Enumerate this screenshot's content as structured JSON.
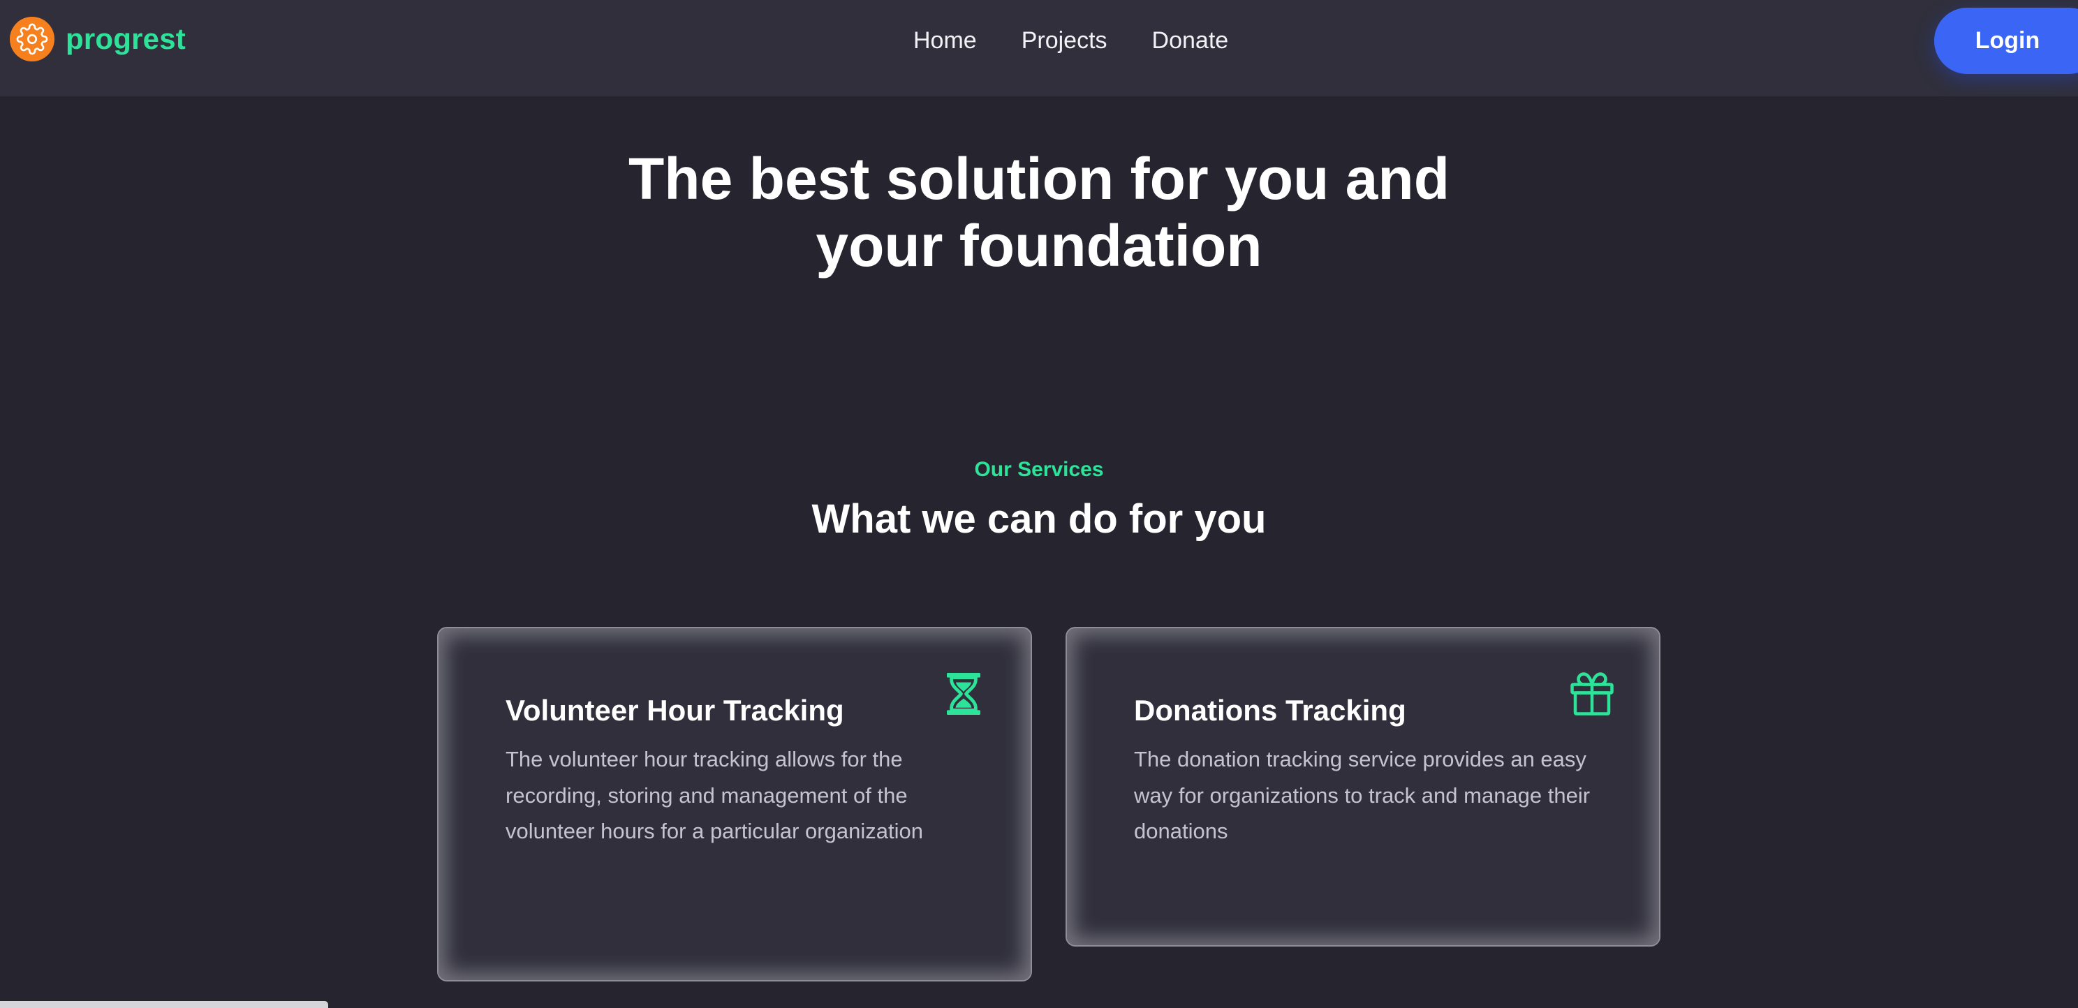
{
  "header": {
    "brand": "progrest",
    "nav": [
      "Home",
      "Projects",
      "Donate"
    ],
    "login_label": "Login"
  },
  "hero": {
    "title_line1": "The best solution for you and",
    "title_line2": "your foundation"
  },
  "services": {
    "eyebrow": "Our Services",
    "title": "What we can do for you",
    "cards": [
      {
        "title": "Volunteer Hour Tracking",
        "text": "The volunteer hour tracking allows for the recording, storing and management of the volunteer hours for a particular organization",
        "icon": "hourglass-icon"
      },
      {
        "title": "Donations Tracking",
        "text": "The donation tracking service provides an easy way for organizations to track and manage their donations",
        "icon": "gift-icon"
      }
    ]
  },
  "colors": {
    "background": "#26252f",
    "header": "#302f3b",
    "accent": "#2de39a",
    "brand_orange": "#f7801e",
    "login_blue": "#3b66f5",
    "card": "#302f3b"
  }
}
